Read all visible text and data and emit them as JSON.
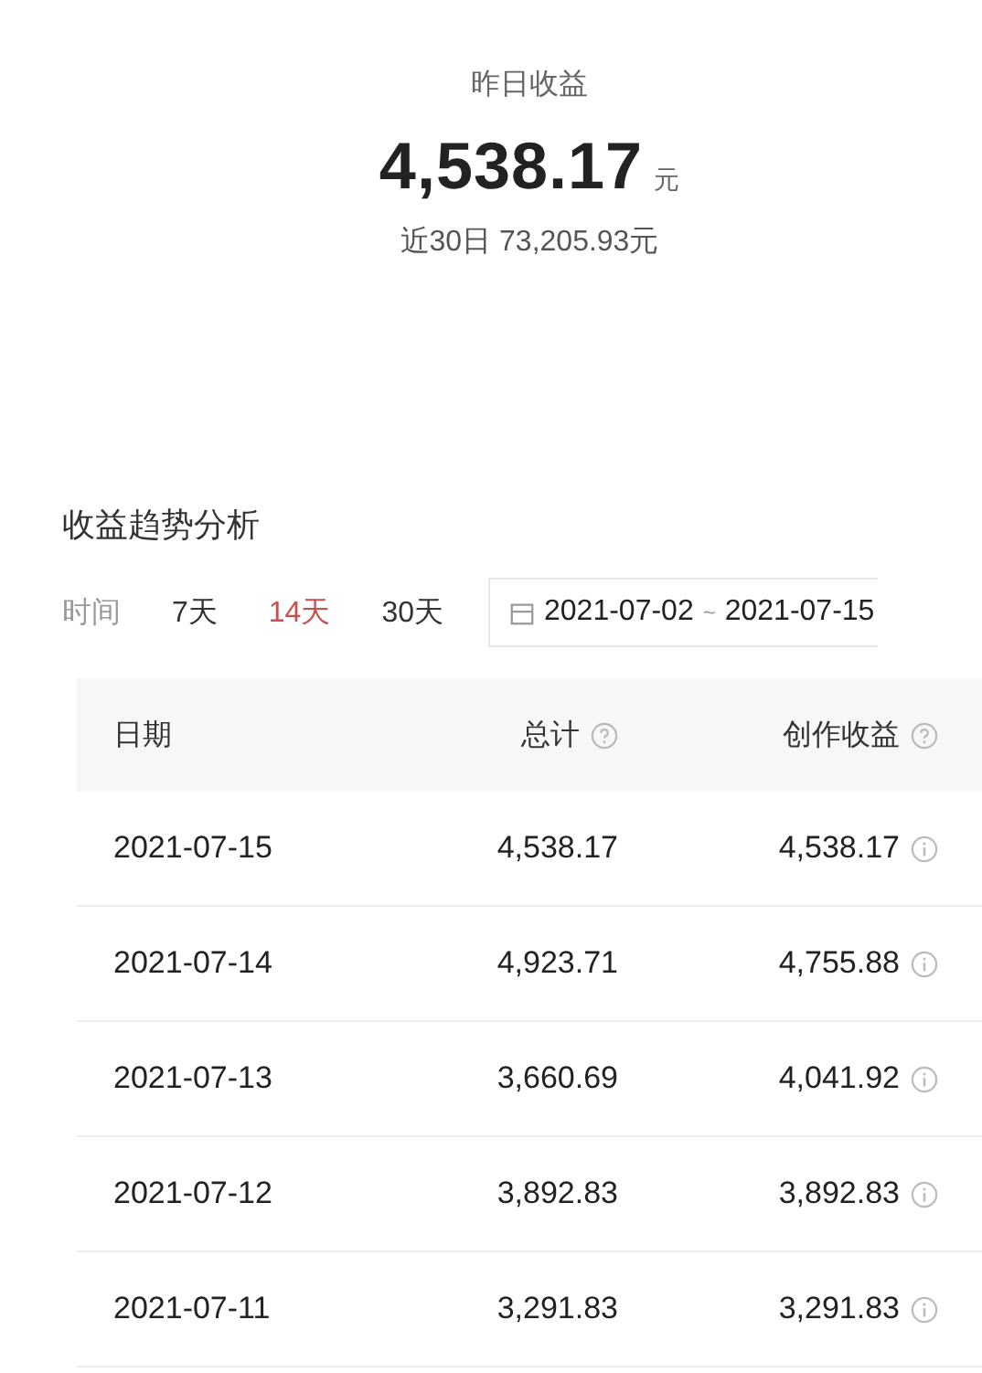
{
  "summary": {
    "title": "昨日收益",
    "amount": "4,538.17",
    "unit": "元",
    "recent": "近30日 73,205.93元"
  },
  "trend": {
    "title": "收益趋势分析",
    "filter_label": "时间",
    "ranges": [
      {
        "label": "7天",
        "selected": false
      },
      {
        "label": "14天",
        "selected": true
      },
      {
        "label": "30天",
        "selected": false
      }
    ],
    "date_range": {
      "start": "2021-07-02",
      "separator": "~",
      "end": "2021-07-15"
    }
  },
  "table": {
    "columns": [
      {
        "label": "日期",
        "help": false
      },
      {
        "label": "总计",
        "help": true
      },
      {
        "label": "创作收益",
        "help": true
      }
    ],
    "rows": [
      {
        "date": "2021-07-15",
        "total": "4,538.17",
        "creation": "4,538.17"
      },
      {
        "date": "2021-07-14",
        "total": "4,923.71",
        "creation": "4,755.88"
      },
      {
        "date": "2021-07-13",
        "total": "3,660.69",
        "creation": "4,041.92"
      },
      {
        "date": "2021-07-12",
        "total": "3,892.83",
        "creation": "3,892.83"
      },
      {
        "date": "2021-07-11",
        "total": "3,291.83",
        "creation": "3,291.83"
      }
    ]
  }
}
